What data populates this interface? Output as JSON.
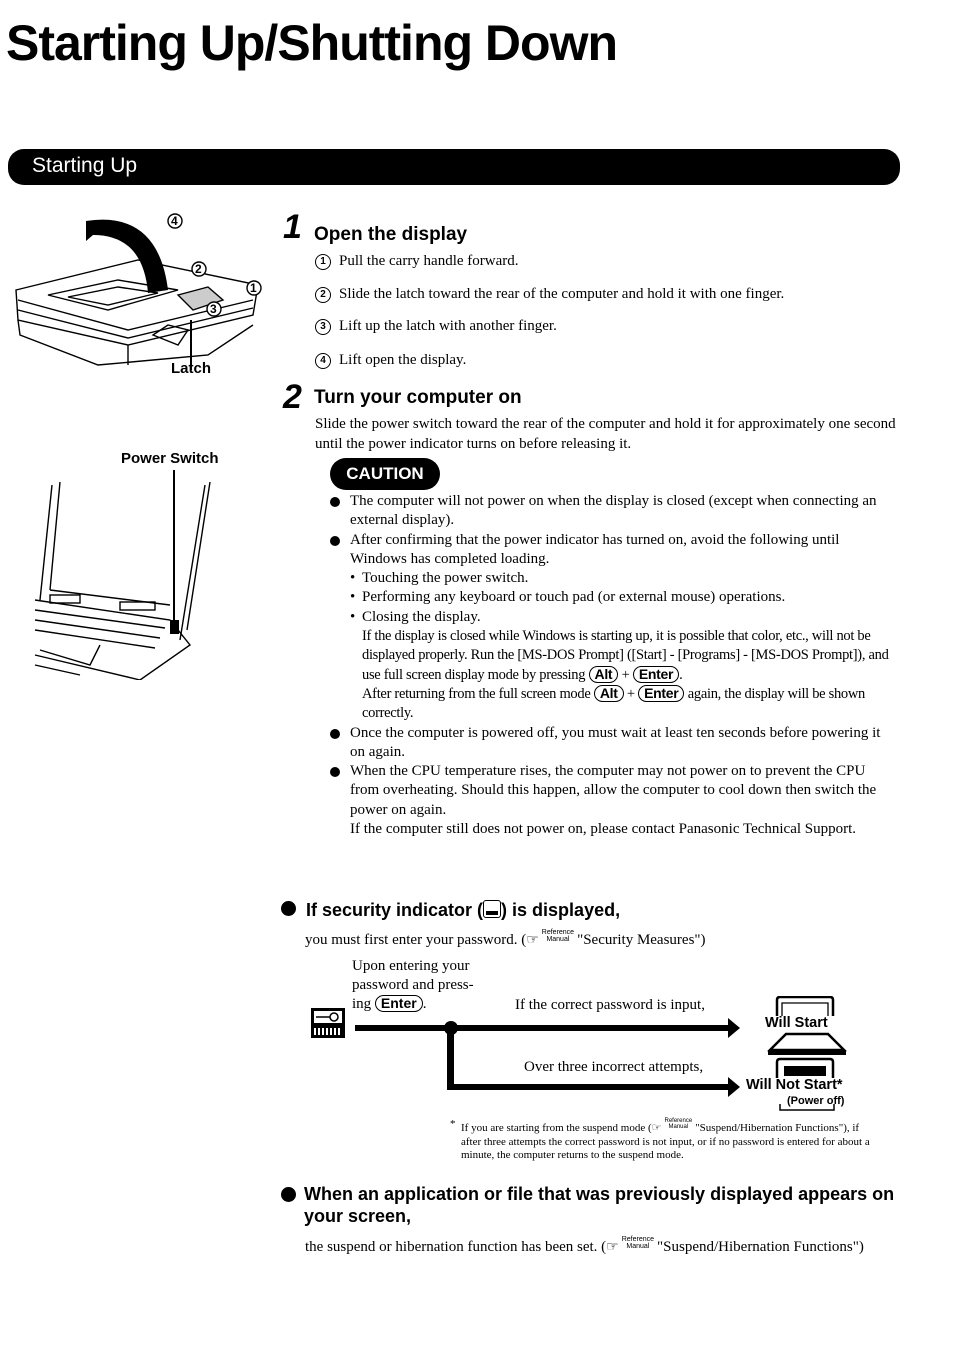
{
  "page": {
    "title": "Starting Up/Shutting Down",
    "section_title": "Starting Up"
  },
  "illustrations": {
    "latch_label": "Latch",
    "power_switch_label": "Power Switch",
    "callouts": [
      "④",
      "②",
      "①",
      "③"
    ]
  },
  "step1": {
    "number": "1",
    "title": "Open the display",
    "items": [
      {
        "marker": "1",
        "text": "Pull the carry handle forward."
      },
      {
        "marker": "2",
        "text": "Slide the latch toward the rear of the computer and hold it with one finger."
      },
      {
        "marker": "3",
        "text": "Lift up the latch with another finger."
      },
      {
        "marker": "4",
        "text": "Lift open the display."
      }
    ]
  },
  "step2": {
    "number": "2",
    "title": "Turn your computer on",
    "body": "Slide the power switch toward the rear of the computer and hold it for approximately one second until the power indicator turns on before releasing it.",
    "caution_label": "CAUTION",
    "caution": {
      "b1": "The computer will not power on when the display is closed (except when connecting an external display).",
      "b2": "After confirming that the power indicator has turned on, avoid the following until Windows has completed loading.",
      "sub1": "Touching the power switch.",
      "sub2": "Performing any keyboard or touch pad (or external mouse) operations.",
      "sub3": "Closing the display.",
      "note1_a": "If the display is closed while Windows is starting up, it is possible that color, etc., will not be displayed properly.  Run the [MS-DOS Prompt] ([Start] - [Programs] - [MS-DOS Prompt]), and use full screen display mode by pressing",
      "note1_plus": "+",
      "note1_end": ".",
      "note2_a": "After returning from the full screen mode",
      "note2_plus": "+",
      "note2_b": "again, the display will be shown correctly.",
      "b3": "Once the computer is powered off, you must wait at least ten seconds before powering it on again.",
      "b4": "When the CPU temperature rises, the computer may not power on to prevent the CPU from overheating.  Should this happen, allow the computer to cool down then switch the power on again.",
      "b4_note": "If the computer still does not power on, please contact Panasonic Technical Support."
    },
    "keys": {
      "alt": "Alt",
      "enter": "Enter"
    }
  },
  "security": {
    "heading_a": "If security indicator (",
    "heading_b": ") is displayed,",
    "body_a": "you must first enter your password. (",
    "ref_top": "Reference",
    "ref_bottom": "Manual",
    "body_ref": "\"Security Measures\")",
    "diagram": {
      "intro_1": "Upon entering your",
      "intro_2": "password and press-",
      "intro_3": "ing",
      "intro_end": ".",
      "correct_label": "If the correct password is input,",
      "incorrect_label": "Over three incorrect attempts,",
      "will_start": "Will Start",
      "will_not_start": "Will Not Start*",
      "power_off": "(Power off)"
    },
    "footnote": {
      "star": "*",
      "a": "If you are starting from the suspend mode (",
      "b": "\"Suspend/Hibernation Functions\"), if after three attempts the correct password is not input, or if no password is entered for about a minute, the computer returns to the suspend mode."
    }
  },
  "resume": {
    "heading": "When an application or file that was previously displayed appears on your screen,",
    "body_a": "the suspend or hibernation function has been set.  (",
    "body_b": "\"Suspend/Hibernation Functions\")"
  }
}
